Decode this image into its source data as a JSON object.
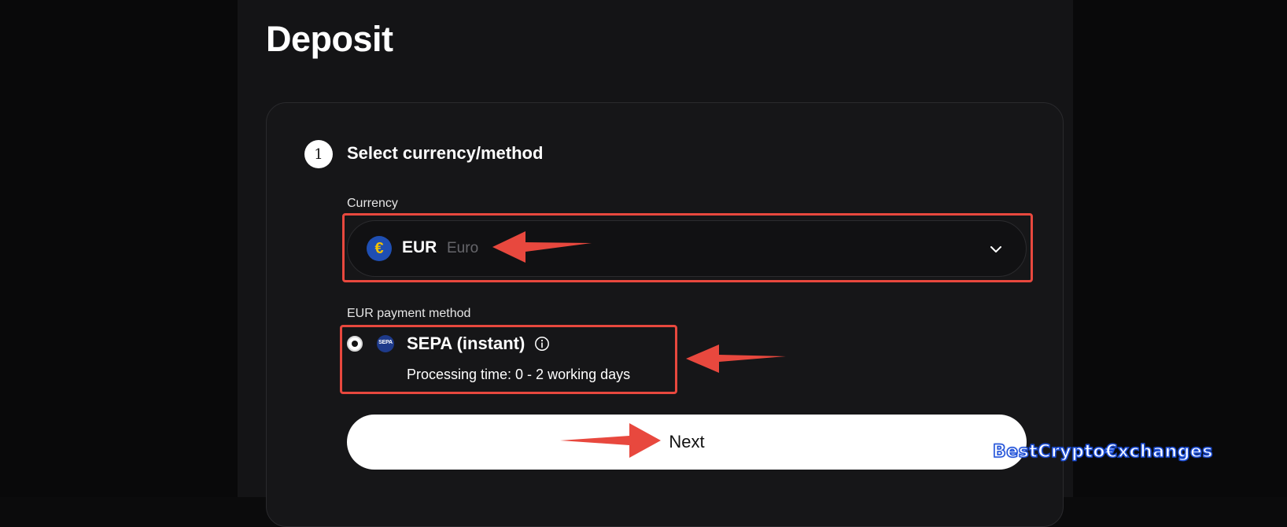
{
  "page": {
    "title": "Deposit"
  },
  "step": {
    "number": "1",
    "title": "Select currency/method"
  },
  "currency": {
    "label": "Currency",
    "selected_code": "EUR",
    "selected_name": "Euro",
    "icon_glyph": "€"
  },
  "payment_method": {
    "label": "EUR payment method",
    "option": {
      "icon_text": "SEPA",
      "name": "SEPA (instant)",
      "processing_time": "Processing time: 0 - 2 working days",
      "selected": true
    }
  },
  "actions": {
    "next_label": "Next"
  },
  "watermark": {
    "text": "BestCrypto€xchanges"
  },
  "colors": {
    "background": "#0b0b0c",
    "panel": "#141416",
    "card": "#161618",
    "accent_highlight": "#e8483e",
    "eur_icon": "#1f4fb3",
    "watermark": "#1d4fd8"
  }
}
